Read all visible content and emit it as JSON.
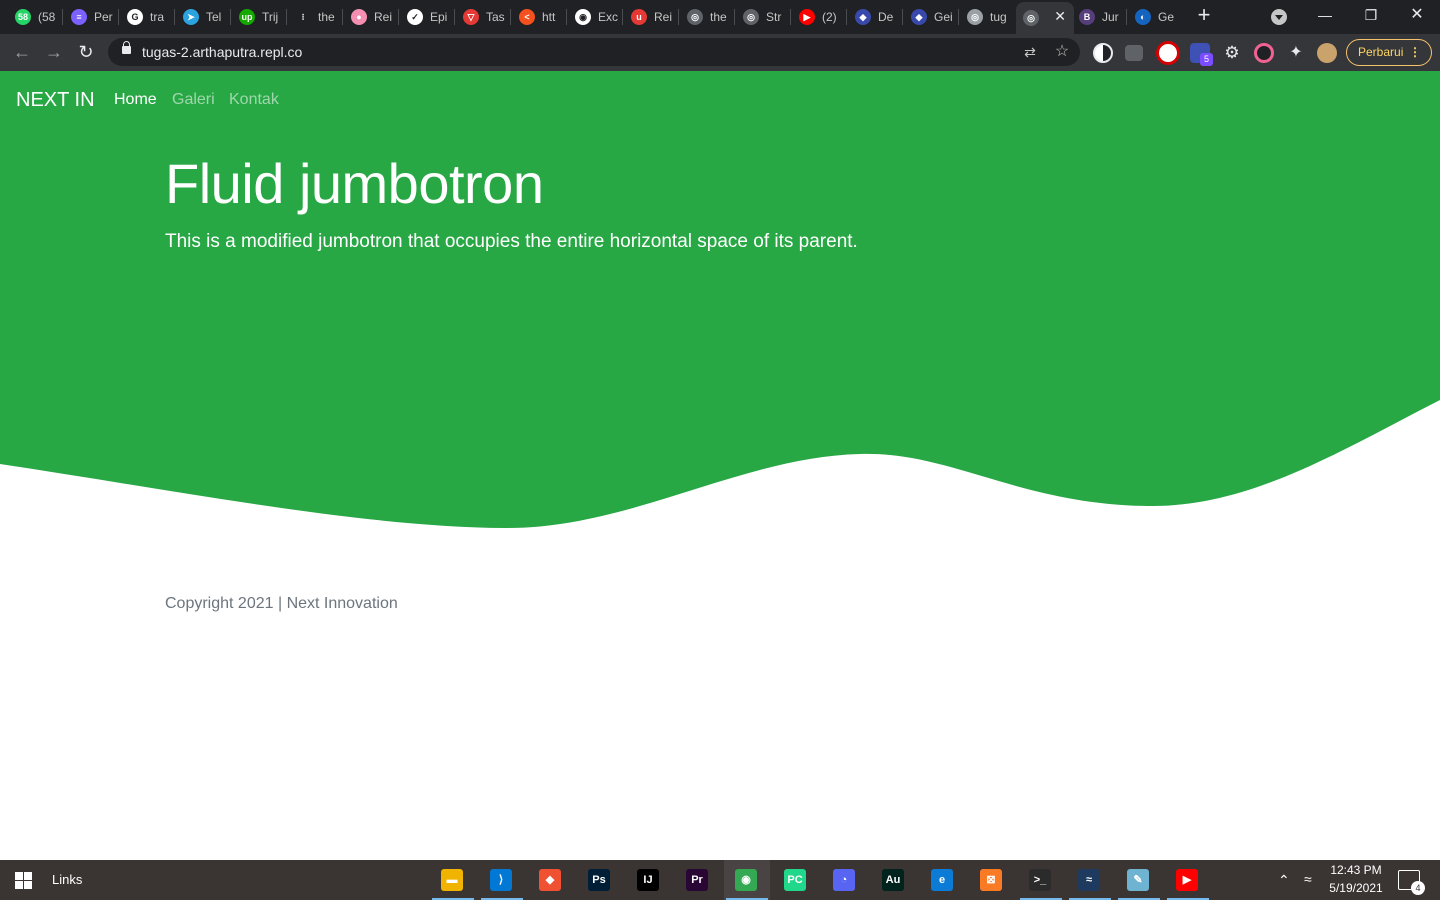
{
  "browser": {
    "tabs": [
      {
        "label": "(58",
        "color": "#25d366",
        "glyph": "58"
      },
      {
        "label": "Per",
        "color": "#7b61ff",
        "glyph": "≡"
      },
      {
        "label": "tra",
        "color": "#ffffff",
        "glyph": "G"
      },
      {
        "label": "Tel",
        "color": "#2aa3df",
        "glyph": "➤"
      },
      {
        "label": "Trij",
        "color": "#14a800",
        "glyph": "up"
      },
      {
        "label": "the",
        "color": "#202124",
        "glyph": "⁝"
      },
      {
        "label": "Rei",
        "color": "#f48fb1",
        "glyph": "●"
      },
      {
        "label": "Epi",
        "color": "#ffffff",
        "glyph": "✓"
      },
      {
        "label": "Tas",
        "color": "#e53935",
        "glyph": "▽"
      },
      {
        "label": "htt",
        "color": "#f4511e",
        "glyph": "<"
      },
      {
        "label": "Exc",
        "color": "#ffffff",
        "glyph": "◉"
      },
      {
        "label": "Rei",
        "color": "#e53935",
        "glyph": "u"
      },
      {
        "label": "the",
        "color": "#5f6368",
        "glyph": "◎"
      },
      {
        "label": "Str",
        "color": "#5f6368",
        "glyph": "◎"
      },
      {
        "label": "(2)",
        "color": "#ff0000",
        "glyph": "▶"
      },
      {
        "label": "De",
        "color": "#3949ab",
        "glyph": "◆"
      },
      {
        "label": "Gei",
        "color": "#3949ab",
        "glyph": "◆"
      },
      {
        "label": "tug",
        "color": "#9aa0a6",
        "glyph": "◎"
      },
      {
        "label": "",
        "color": "#5f6368",
        "glyph": "◎",
        "active": true
      },
      {
        "label": "Jur",
        "color": "#563d7c",
        "glyph": "B"
      },
      {
        "label": "Ge",
        "color": "#1565c0",
        "glyph": "◐"
      }
    ],
    "new_tab": "+",
    "url": "tugas-2.arthaputra.repl.co",
    "update_label": "Perbarui",
    "extension_badge": "5"
  },
  "page": {
    "brand": "NEXT IN",
    "nav": [
      {
        "label": "Home",
        "active": true
      },
      {
        "label": "Galeri",
        "active": false
      },
      {
        "label": "Kontak",
        "active": false
      }
    ],
    "hero_title": "Fluid jumbotron",
    "hero_lead": "This is a modified jumbotron that occupies the entire horizontal space of its parent.",
    "footer": "Copyright 2021 | Next Innovation",
    "colors": {
      "primary": "#28a745",
      "footer_text": "#6c757d"
    }
  },
  "taskbar": {
    "links_label": "Links",
    "apps": [
      {
        "name": "file-explorer",
        "color": "#f0b400",
        "glyph": "▬"
      },
      {
        "name": "vscode",
        "color": "#0078d4",
        "glyph": "⟩"
      },
      {
        "name": "git-gui",
        "color": "#f05133",
        "glyph": "◆"
      },
      {
        "name": "photoshop",
        "color": "#001e36",
        "glyph": "Ps"
      },
      {
        "name": "intellij",
        "color": "#000000",
        "glyph": "IJ"
      },
      {
        "name": "premiere",
        "color": "#2a0634",
        "glyph": "Pr"
      },
      {
        "name": "chrome",
        "color": "#34a853",
        "glyph": "◉"
      },
      {
        "name": "pycharm",
        "color": "#21d789",
        "glyph": "PC"
      },
      {
        "name": "discord",
        "color": "#5865f2",
        "glyph": "◔"
      },
      {
        "name": "audition",
        "color": "#00231d",
        "glyph": "Au"
      },
      {
        "name": "edge",
        "color": "#0c7bd6",
        "glyph": "e"
      },
      {
        "name": "xampp",
        "color": "#fb7a24",
        "glyph": "⊠"
      },
      {
        "name": "terminal",
        "color": "#2b2b2b",
        "glyph": ">_"
      },
      {
        "name": "mysql-workbench",
        "color": "#1e3a5f",
        "glyph": "≈"
      },
      {
        "name": "notepad",
        "color": "#6fb3d2",
        "glyph": "✎"
      },
      {
        "name": "youtube",
        "color": "#ff0000",
        "glyph": "▶"
      }
    ],
    "time": "12:43 PM",
    "date": "5/19/2021",
    "notification_count": "4"
  }
}
